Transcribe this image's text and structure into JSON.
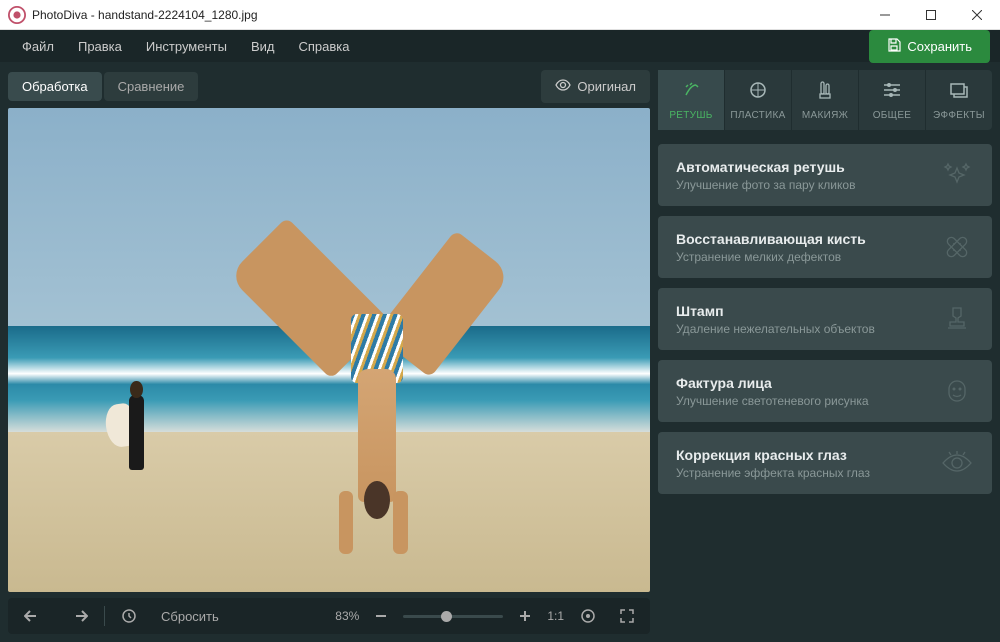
{
  "window": {
    "app_name": "PhotoDiva",
    "file_name": "handstand-2224104_1280.jpg"
  },
  "menu": {
    "items": [
      "Файл",
      "Правка",
      "Инструменты",
      "Вид",
      "Справка"
    ],
    "save_label": "Сохранить"
  },
  "toolbar": {
    "tabs": {
      "edit_label": "Обработка",
      "compare_label": "Сравнение"
    },
    "original_label": "Оригинал"
  },
  "bottom": {
    "reset_label": "Сбросить",
    "zoom_label": "83%",
    "ratio_label": "1:1"
  },
  "tool_tabs": [
    {
      "id": "retush",
      "label": "РЕТУШЬ"
    },
    {
      "id": "plastika",
      "label": "ПЛАСТИКА"
    },
    {
      "id": "makeup",
      "label": "МАКИЯЖ"
    },
    {
      "id": "general",
      "label": "ОБЩЕЕ"
    },
    {
      "id": "effects",
      "label": "ЭФФЕКТЫ"
    }
  ],
  "cards": [
    {
      "title": "Автоматическая ретушь",
      "sub": "Улучшение фото за пару кликов"
    },
    {
      "title": "Восстанавливающая кисть",
      "sub": "Устранение мелких дефектов"
    },
    {
      "title": "Штамп",
      "sub": "Удаление нежелательных объектов"
    },
    {
      "title": "Фактура лица",
      "sub": "Улучшение светотеневого рисунка"
    },
    {
      "title": "Коррекция красных глаз",
      "sub": "Устранение эффекта красных глаз"
    }
  ]
}
